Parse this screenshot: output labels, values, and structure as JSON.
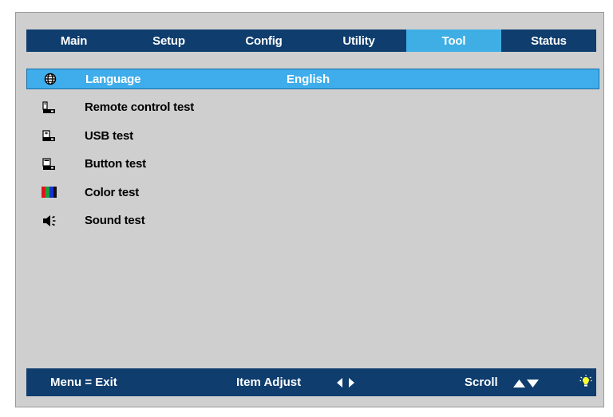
{
  "tabs": [
    {
      "label": "Main"
    },
    {
      "label": "Setup"
    },
    {
      "label": "Config"
    },
    {
      "label": "Utility"
    },
    {
      "label": "Tool"
    },
    {
      "label": "Status"
    }
  ],
  "active_tab": "Tool",
  "menu": {
    "items": [
      {
        "label": "Language",
        "value": "English",
        "icon": "globe-icon"
      },
      {
        "label": "Remote control test",
        "icon": "remote-test-icon"
      },
      {
        "label": "USB test",
        "icon": "usb-test-icon"
      },
      {
        "label": "Button test",
        "icon": "button-test-icon"
      },
      {
        "label": "Color test",
        "icon": "color-bars-icon"
      },
      {
        "label": "Sound test",
        "icon": "speaker-icon"
      }
    ]
  },
  "footer": {
    "exit_label": "Menu = Exit",
    "adjust_label": "Item Adjust",
    "scroll_label": "Scroll",
    "icons": [
      "left-right-arrows-icon",
      "up-down-arrows-icon",
      "lightbulb-icon"
    ]
  },
  "colors": {
    "bar_navy": "#0e3d6e",
    "highlight_blue": "#3faee5",
    "panel_gray": "#cfcfcf"
  }
}
